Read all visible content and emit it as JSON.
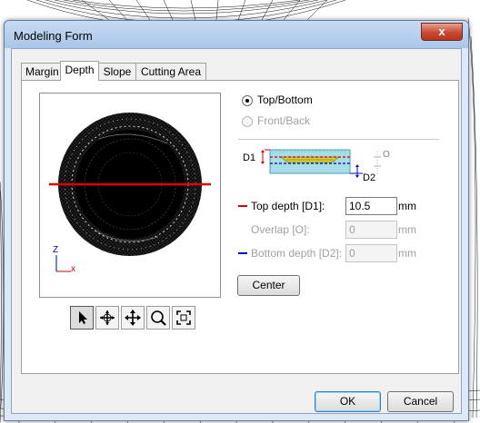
{
  "dialog": {
    "title": "Modeling Form",
    "close_glyph": "x"
  },
  "tabs": [
    {
      "label": "Margin",
      "active": false
    },
    {
      "label": "Depth",
      "active": true
    },
    {
      "label": "Slope",
      "active": false
    },
    {
      "label": "Cutting Area",
      "active": false
    }
  ],
  "viewport": {
    "axis_z": "Z",
    "axis_x": "x",
    "section_line_color": "#e00000"
  },
  "view_toolbar": [
    {
      "name": "select-arrow-icon",
      "pressed": true
    },
    {
      "name": "rotate-icon",
      "pressed": false
    },
    {
      "name": "pan-icon",
      "pressed": false
    },
    {
      "name": "zoom-icon",
      "pressed": false
    },
    {
      "name": "fit-view-icon",
      "pressed": false
    }
  ],
  "direction": {
    "top_bottom": {
      "label": "Top/Bottom",
      "selected": true,
      "enabled": true
    },
    "front_back": {
      "label": "Front/Back",
      "selected": false,
      "enabled": false
    }
  },
  "diagram": {
    "d1": "D1",
    "d2": "D2",
    "o": "O"
  },
  "fields": {
    "top_depth": {
      "label": "Top depth [D1]:",
      "value": "10.5",
      "unit": "mm",
      "enabled": true,
      "marker_color": "#d00000"
    },
    "overlap": {
      "label": "Overlap [O]:",
      "value": "0",
      "unit": "mm",
      "enabled": false
    },
    "bottom_depth": {
      "label": "Bottom depth [D2]:",
      "value": "0",
      "unit": "mm",
      "enabled": false,
      "marker_color": "#0000c0"
    }
  },
  "buttons": {
    "center": "Center",
    "ok": "OK",
    "cancel": "Cancel"
  },
  "colors": {
    "title_bar": "#b5d0ee",
    "close_button": "#c74a33",
    "face": "#f0f0f0"
  }
}
